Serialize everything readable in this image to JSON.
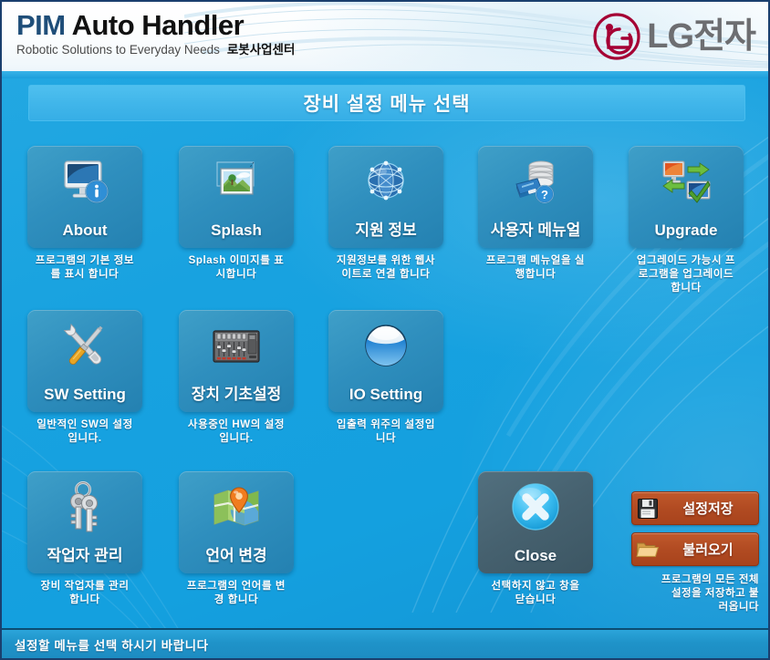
{
  "header": {
    "brand_prefix": "PIM",
    "brand_rest": " Auto Handler",
    "tagline": "Robotic Solutions to Everyday Needs",
    "tagline_kr": "로봇사업센터",
    "logo_text": "LG전자",
    "logo_color": "#a50034",
    "logo_text_color": "#6d6e71"
  },
  "title": {
    "text": "장비 설정 메뉴 선택"
  },
  "tiles": [
    {
      "id": "about",
      "icon": "monitor-info-icon",
      "label": "About",
      "desc": "프로그램의 기본 정보\n를 표시 합니다"
    },
    {
      "id": "splash",
      "icon": "picture-frame-icon",
      "label": "Splash",
      "desc": "Splash 이미지를 표\n시합니다"
    },
    {
      "id": "support-info",
      "icon": "globe-network-icon",
      "label": "지원 정보",
      "desc": "지원정보를 위한 웹사\n이트로 연결 합니다"
    },
    {
      "id": "user-manual",
      "icon": "disk-help-icon",
      "label": "사용자 메뉴얼",
      "desc": "프로그램 메뉴얼을 실\n행합니다"
    },
    {
      "id": "upgrade",
      "icon": "upgrade-arrows-icon",
      "label": "Upgrade",
      "desc": "업그레이드 가능시 프\n로그램을 업그레이드\n합니다"
    },
    {
      "id": "sw-setting",
      "icon": "wrench-screwdriver-icon",
      "label": "SW Setting",
      "desc": "일반적인 SW의 설정\n입니다."
    },
    {
      "id": "device-base-setting",
      "icon": "mixer-console-icon",
      "label": "장치 기초설정",
      "desc": "사용중인 HW의 설정\n입니다."
    },
    {
      "id": "io-setting",
      "icon": "blue-sphere-icon",
      "label": "IO Setting",
      "desc": "입출력 위주의 설정입\n니다"
    },
    {
      "id": "operator-management",
      "icon": "keys-icon",
      "label": "작업자 관리",
      "desc": "장비 작업자를 관리\n합니다"
    },
    {
      "id": "change-language",
      "icon": "map-pin-icon",
      "label": "언어 변경",
      "desc": "프로그램의 언어를 변\n경 합니다"
    },
    {
      "id": "close",
      "icon": "close-x-circle-icon",
      "label": "Close",
      "desc": "선택하지 않고 창을\n닫습니다"
    }
  ],
  "actions": {
    "save_icon": "floppy-disk-icon",
    "save_label": "설정저장",
    "load_icon": "open-folder-icon",
    "load_label": "불러오기",
    "desc": "프로그램의 모든 전체\n설정을 저장하고 불\n러옵니다",
    "button_color": "#b14b22"
  },
  "statusbar": {
    "text": "설정할 메뉴를 선택 하시기 바랍니다"
  },
  "theme": {
    "background": "#18a2e0",
    "title_bar": "#41b6ea",
    "tile": "#2f8fbe",
    "close_tile": "#46616f"
  }
}
